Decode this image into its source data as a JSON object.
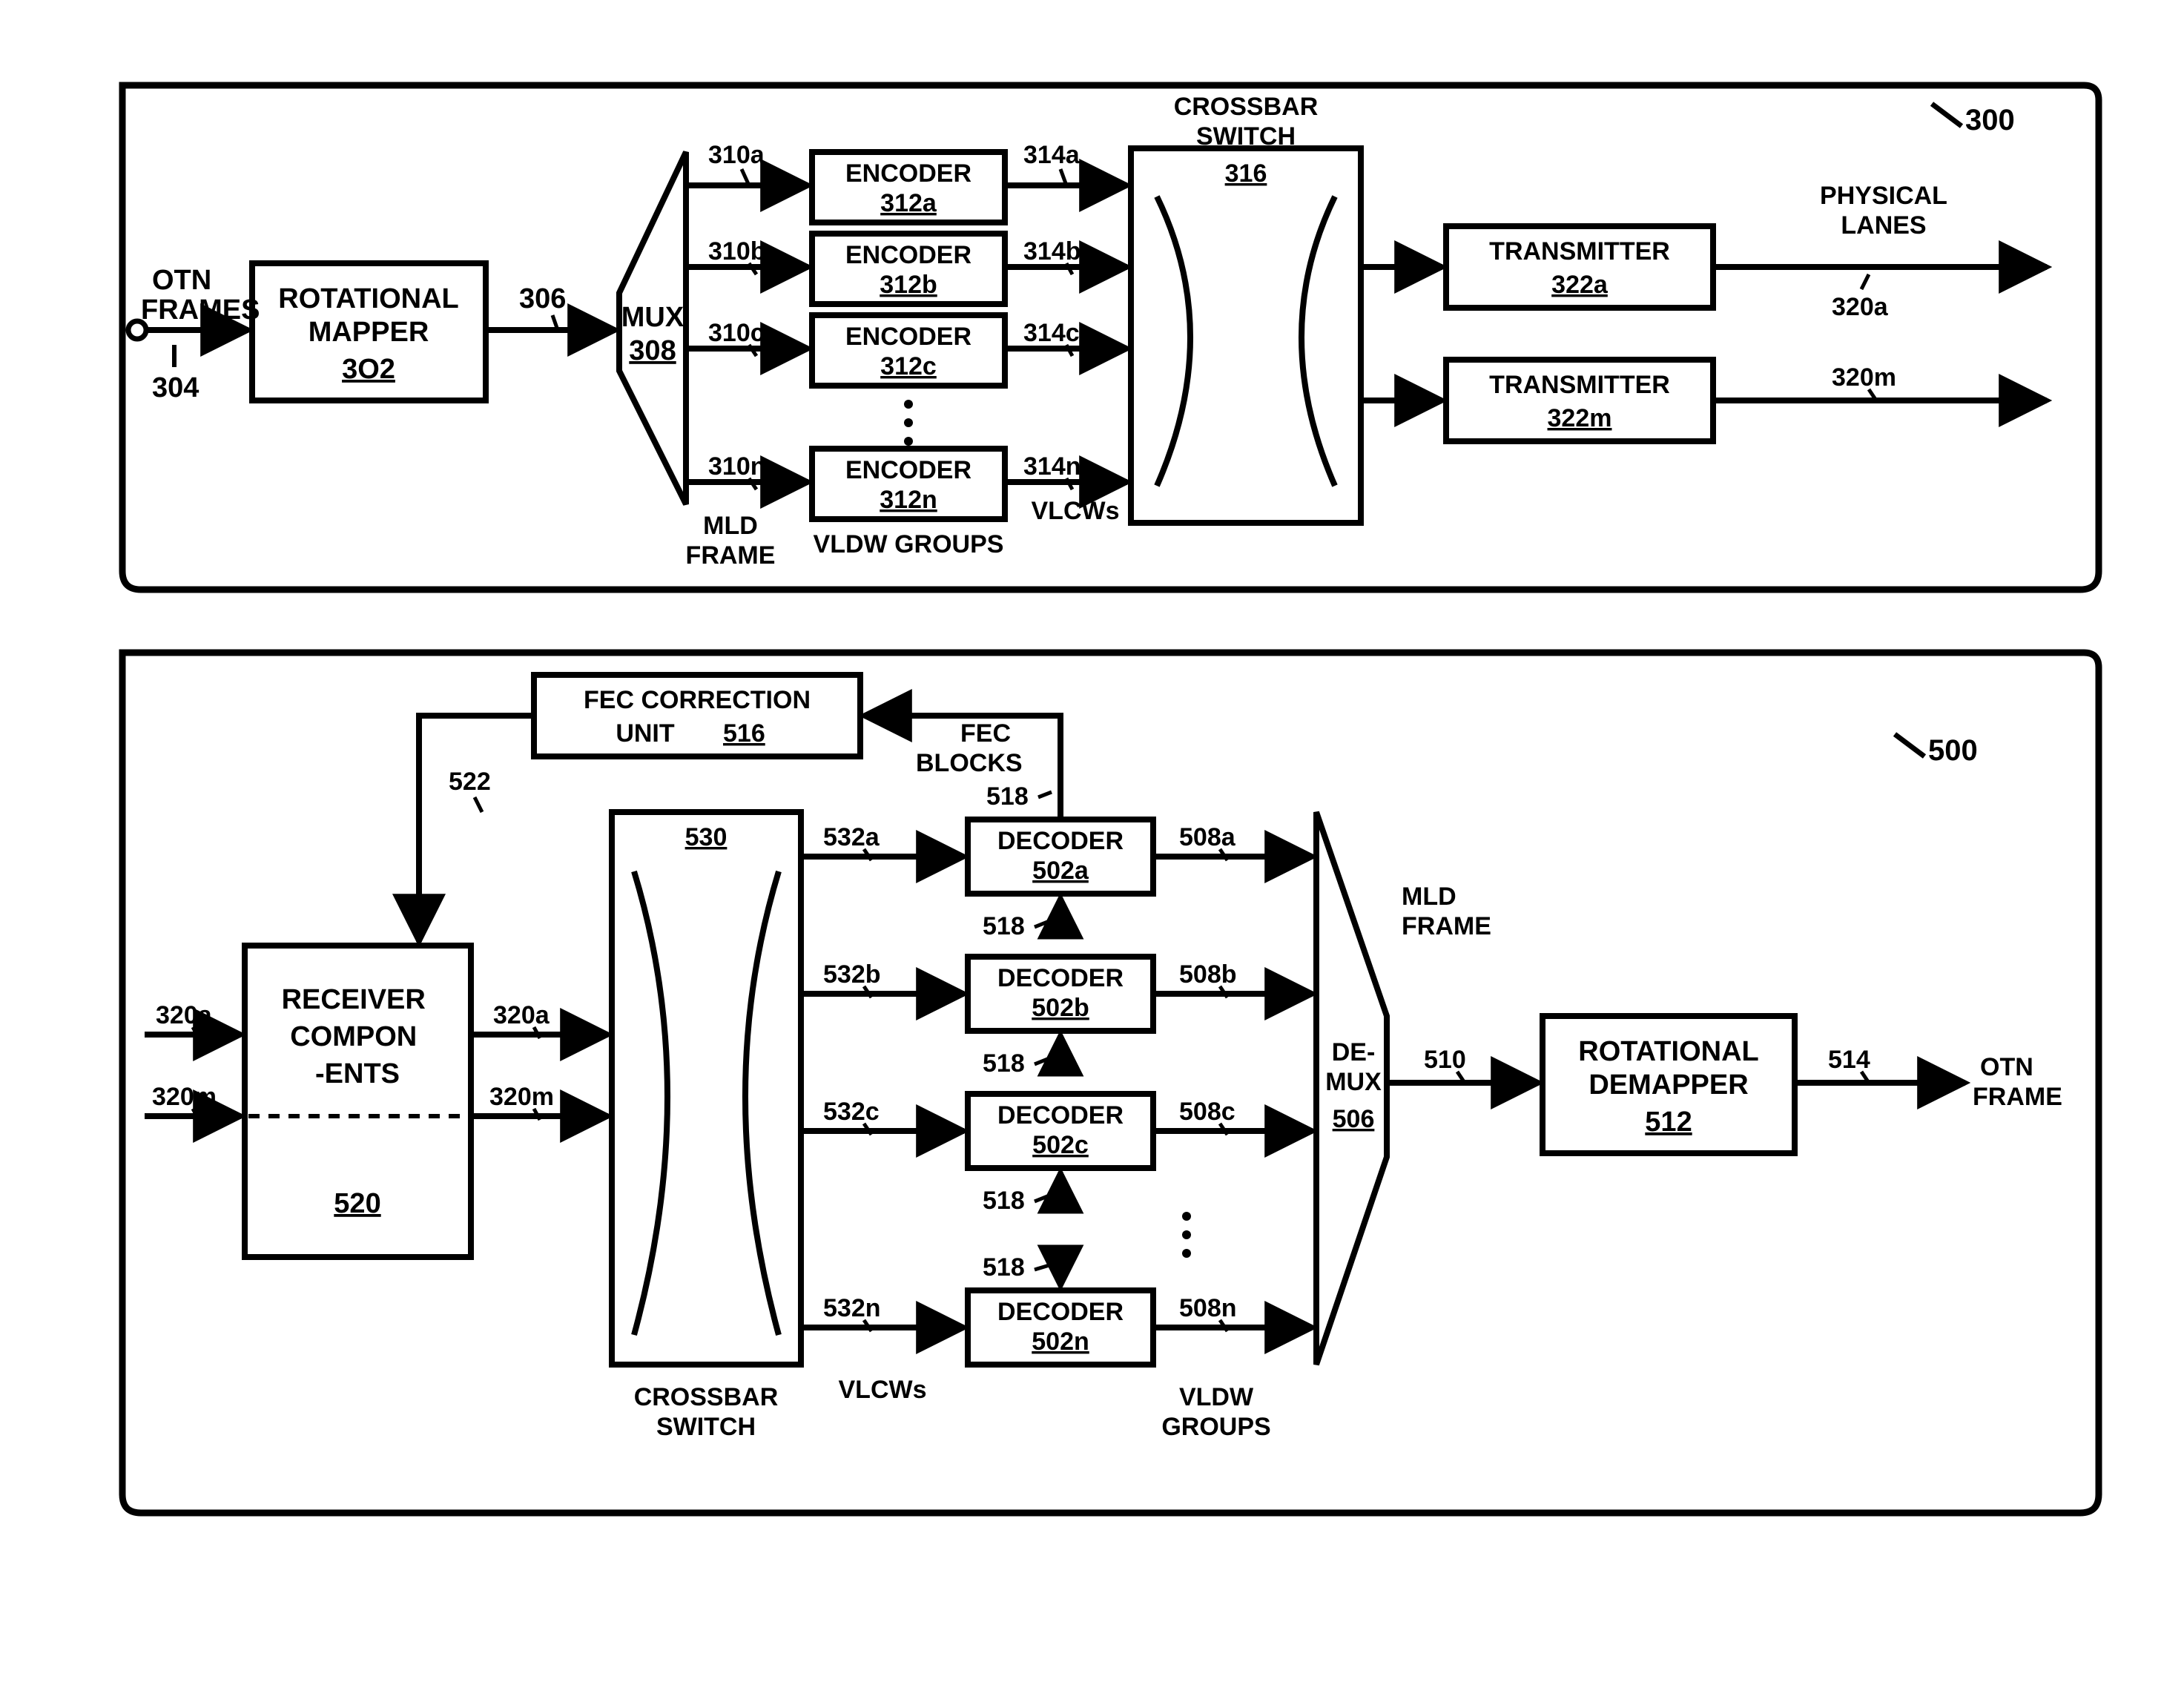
{
  "fig300": {
    "id": "300",
    "input_label": "OTN\nFRAMES",
    "mapper": {
      "title": "ROTATIONAL\nMAPPER",
      "ref": "3O2"
    },
    "lbl_304": "304",
    "lbl_306": "306",
    "mux": {
      "title": "MUX",
      "ref": "308"
    },
    "enc_rows": [
      {
        "in": "310a",
        "title": "ENCODER",
        "ref": "312a",
        "out": "314a"
      },
      {
        "in": "310b",
        "title": "ENCODER",
        "ref": "312b",
        "out": "314b"
      },
      {
        "in": "310c",
        "title": "ENCODER",
        "ref": "312c",
        "out": "314c"
      },
      {
        "in": "310n",
        "title": "ENCODER",
        "ref": "312n",
        "out": "314n"
      }
    ],
    "mld_frame": "MLD\nFRAME",
    "vldw_groups": "VLDW GROUPS",
    "vlcws": "VLCWs",
    "crossbar": {
      "title": "CROSSBAR\nSWITCH",
      "ref": "316"
    },
    "tx": [
      {
        "title": "TRANSMITTER",
        "ref": "322a",
        "out": "320a"
      },
      {
        "title": "TRANSMITTER",
        "ref": "322m",
        "out": "320m"
      }
    ],
    "physical_lanes": "PHYSICAL\nLANES"
  },
  "fig500": {
    "id": "500",
    "receiver": {
      "title": "RECEIVER\nCOMPON\n-ENTS",
      "ref": "520"
    },
    "in_top": "320a",
    "in_bot": "320m",
    "mid_top": "320a",
    "mid_bot": "320m",
    "fec": {
      "title": "FEC CORRECTION\nUNIT",
      "ref": "516"
    },
    "lbl_522": "522",
    "cross": {
      "title": "CROSSBAR\nSWITCH",
      "ref": "530"
    },
    "dec_rows": [
      {
        "in": "532a",
        "title": "DECODER",
        "ref": "502a",
        "out": "508a"
      },
      {
        "in": "532b",
        "title": "DECODER",
        "ref": "502b",
        "out": "508b"
      },
      {
        "in": "532c",
        "title": "DECODER",
        "ref": "502c",
        "out": "508c"
      },
      {
        "in": "532n",
        "title": "DECODER",
        "ref": "502n",
        "out": "508n"
      }
    ],
    "lbl_518": "518",
    "fec_blocks": "FEC\nBLOCKS",
    "vlcws": "VLCWs",
    "vldw_groups": "VLDW\nGROUPS",
    "demux": {
      "title": "DE-\nMUX",
      "ref": "506"
    },
    "mld_frame": "MLD\nFRAME",
    "lbl_510": "510",
    "demapper": {
      "title": "ROTATIONAL\nDEMAPPER",
      "ref": "512"
    },
    "lbl_514": "514",
    "otn_frame": "OTN\nFRAME"
  }
}
